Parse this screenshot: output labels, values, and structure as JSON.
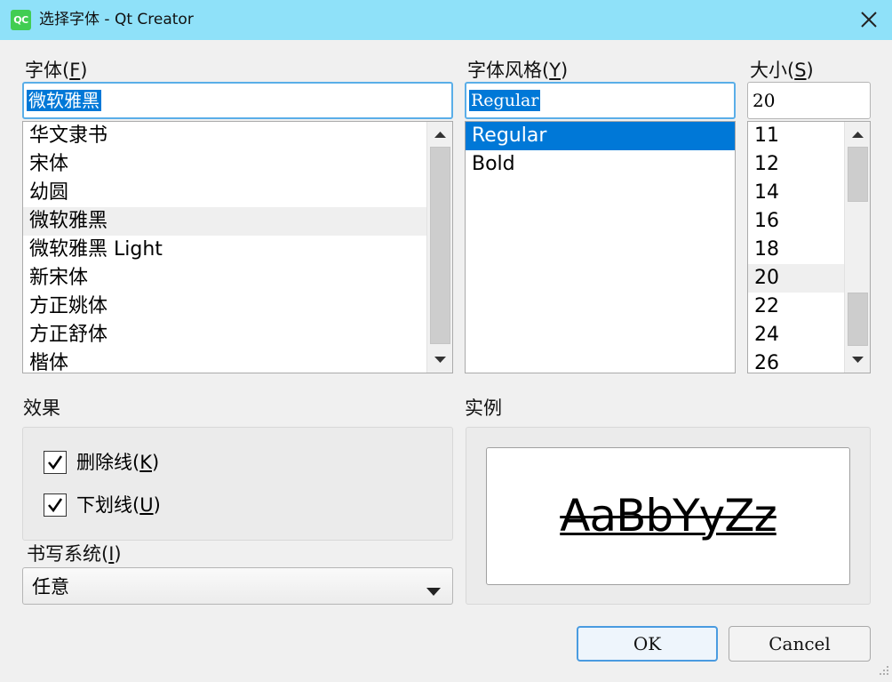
{
  "window": {
    "title": "选择字体 - Qt Creator",
    "icon_text": "QC",
    "icon": "qt-creator-icon",
    "close_icon": "close-icon"
  },
  "family": {
    "label": "字体",
    "mnemonic": "F",
    "value": "微软雅黑",
    "items": [
      "华文隶书",
      "宋体",
      "幼圆",
      "微软雅黑",
      "微软雅黑 Light",
      "新宋体",
      "方正姚体",
      "方正舒体",
      "楷体"
    ],
    "current": "微软雅黑"
  },
  "style": {
    "label": "字体风格",
    "mnemonic": "Y",
    "value": "Regular",
    "items": [
      "Regular",
      "Bold"
    ],
    "selected": "Regular"
  },
  "size": {
    "label": "大小",
    "mnemonic": "S",
    "value": "20",
    "items": [
      "11",
      "12",
      "14",
      "16",
      "18",
      "20",
      "22",
      "24",
      "26"
    ],
    "current": "20"
  },
  "effects": {
    "label": "效果",
    "strikeout": {
      "label": "删除线",
      "mnemonic": "K",
      "checked": true
    },
    "underline": {
      "label": "下划线",
      "mnemonic": "U",
      "checked": true
    }
  },
  "writing_system": {
    "label": "书写系统",
    "mnemonic": "I",
    "value": "任意"
  },
  "sample": {
    "label": "实例",
    "text": "AaBbYyZz"
  },
  "buttons": {
    "ok": "OK",
    "cancel": "Cancel"
  },
  "colors": {
    "titlebar": "#8fe1f9",
    "selection": "#0078d7",
    "focus_border": "#5aaee8"
  }
}
